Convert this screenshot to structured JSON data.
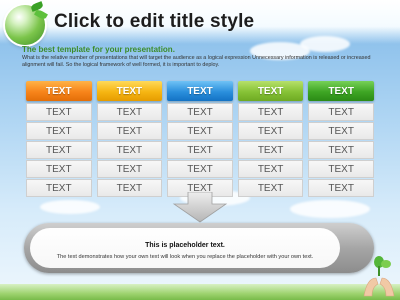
{
  "slide": {
    "title": "Click to edit title style",
    "subtitle": "The best template for your presentation.",
    "description": "What is the relative number of presentations that will target the audience as a logical expression Unnecessary information is released or increased alignment will fail. So the logical framework of well formed, it is important to deploy."
  },
  "table": {
    "headers": [
      "TEXT",
      "TEXT",
      "TEXT",
      "TEXT",
      "TEXT"
    ],
    "rows": [
      [
        "TEXT",
        "TEXT",
        "TEXT",
        "TEXT",
        "TEXT"
      ],
      [
        "TEXT",
        "TEXT",
        "TEXT",
        "TEXT",
        "TEXT"
      ],
      [
        "TEXT",
        "TEXT",
        "TEXT",
        "TEXT",
        "TEXT"
      ],
      [
        "TEXT",
        "TEXT",
        "TEXT",
        "TEXT",
        "TEXT"
      ],
      [
        "TEXT",
        "TEXT",
        "TEXT",
        "TEXT",
        "TEXT"
      ]
    ],
    "header_colors": [
      "#f7841a",
      "#f6b512",
      "#2a8fdc",
      "#86c236",
      "#3ea524"
    ]
  },
  "placeholder": {
    "title": "This is placeholder text.",
    "text": "The text demonstrates how your own text will look when you replace the placeholder with your own text."
  },
  "icons": {
    "globe": "globe-icon",
    "arrow": "down-arrow-icon",
    "hands": "hands-holding-plant-icon"
  }
}
